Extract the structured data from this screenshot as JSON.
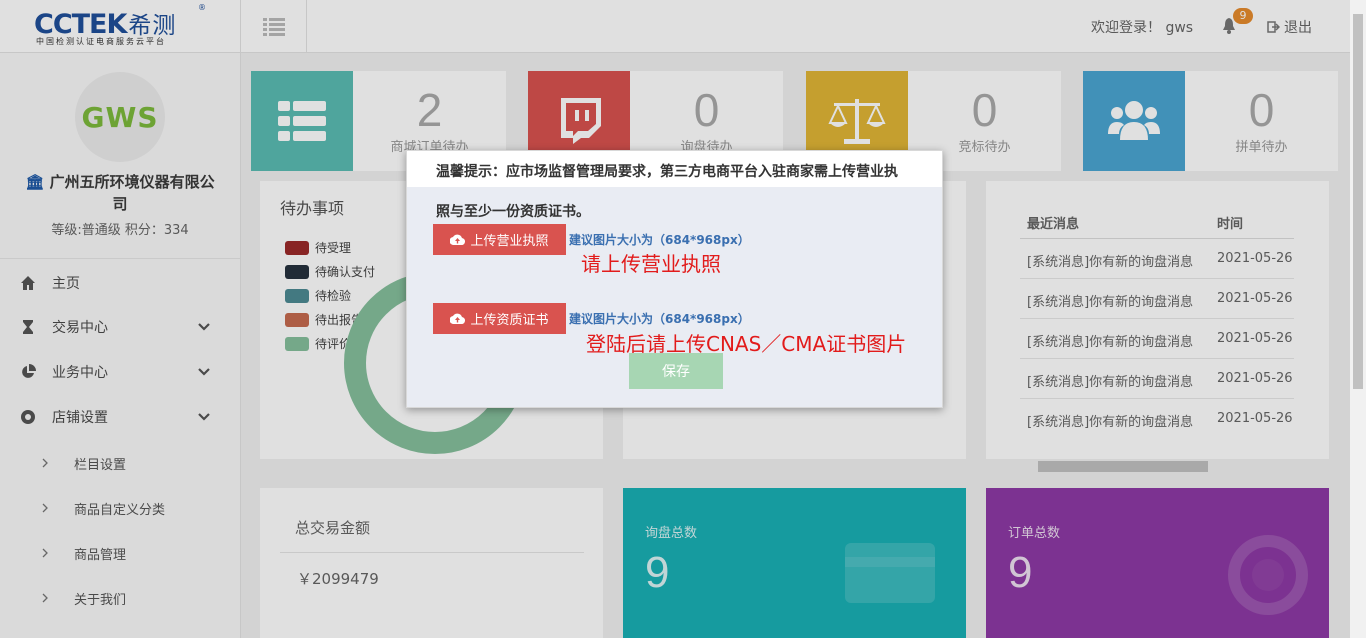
{
  "header": {
    "logo_main": "CCTEK",
    "logo_cn": "希测",
    "logo_reg": "®",
    "logo_sub": "中国检测认证电商服务云平台",
    "welcome": "欢迎登录！ gws",
    "notif_count": "9",
    "logout": "退出"
  },
  "sidebar": {
    "avatar_text": "GWS",
    "company": "广州五所环境仪器有限公司",
    "level": "等级:普通级  积分：334",
    "nav": [
      {
        "label": "主页"
      },
      {
        "label": "交易中心"
      },
      {
        "label": "业务中心"
      },
      {
        "label": "店铺设置"
      }
    ],
    "sub": [
      {
        "label": "栏目设置"
      },
      {
        "label": "商品自定义分类"
      },
      {
        "label": "商品管理"
      },
      {
        "label": "关于我们"
      }
    ]
  },
  "stats": [
    {
      "value": "2",
      "caption": "商城订单待办",
      "color": "#5bbcb3"
    },
    {
      "value": "0",
      "caption": "询盘待办",
      "color": "#d9534f"
    },
    {
      "value": "0",
      "caption": "竞标待办",
      "color": "#e1b636"
    },
    {
      "value": "0",
      "caption": "拼单待办",
      "color": "#4aa6d2"
    }
  ],
  "todo": {
    "title": "待办事项",
    "legend": [
      {
        "label": "待受理",
        "color": "#9b2a2a"
      },
      {
        "label": "待确认支付",
        "color": "#26323e"
      },
      {
        "label": "待检验",
        "color": "#4d8a93"
      },
      {
        "label": "待出报告",
        "color": "#c56a4f"
      },
      {
        "label": "待评价",
        "color": "#86c09d"
      }
    ]
  },
  "messages": {
    "col_msg": "最近消息",
    "col_time": "时间",
    "rows": [
      {
        "msg": "[系统消息]你有新的询盘消息",
        "time": "2021-05-26"
      },
      {
        "msg": "[系统消息]你有新的询盘消息",
        "time": "2021-05-26"
      },
      {
        "msg": "[系统消息]你有新的询盘消息",
        "time": "2021-05-26"
      },
      {
        "msg": "[系统消息]你有新的询盘消息",
        "time": "2021-05-26"
      },
      {
        "msg": "[系统消息]你有新的询盘消息",
        "time": "2021-05-26"
      }
    ]
  },
  "totals": {
    "amount_label": "总交易金额",
    "amount_value": "￥2099479",
    "inquiry_label": "询盘总数",
    "inquiry_value": "9",
    "order_label": "订单总数",
    "order_value": "9"
  },
  "modal": {
    "tip_line1": "温馨提示：应市场监督管理局要求，第三方电商平台入驻商家需上传营业执",
    "tip_line2": "照与至少一份资质证书。",
    "upload_license": "上传营业执照",
    "upload_cert": "上传资质证书",
    "hint": "建议图片大小为（684*968px）",
    "note1": "请上传营业执照",
    "note2": "登陆后请上传CNAS／CMA证书图片",
    "save": "保存"
  }
}
